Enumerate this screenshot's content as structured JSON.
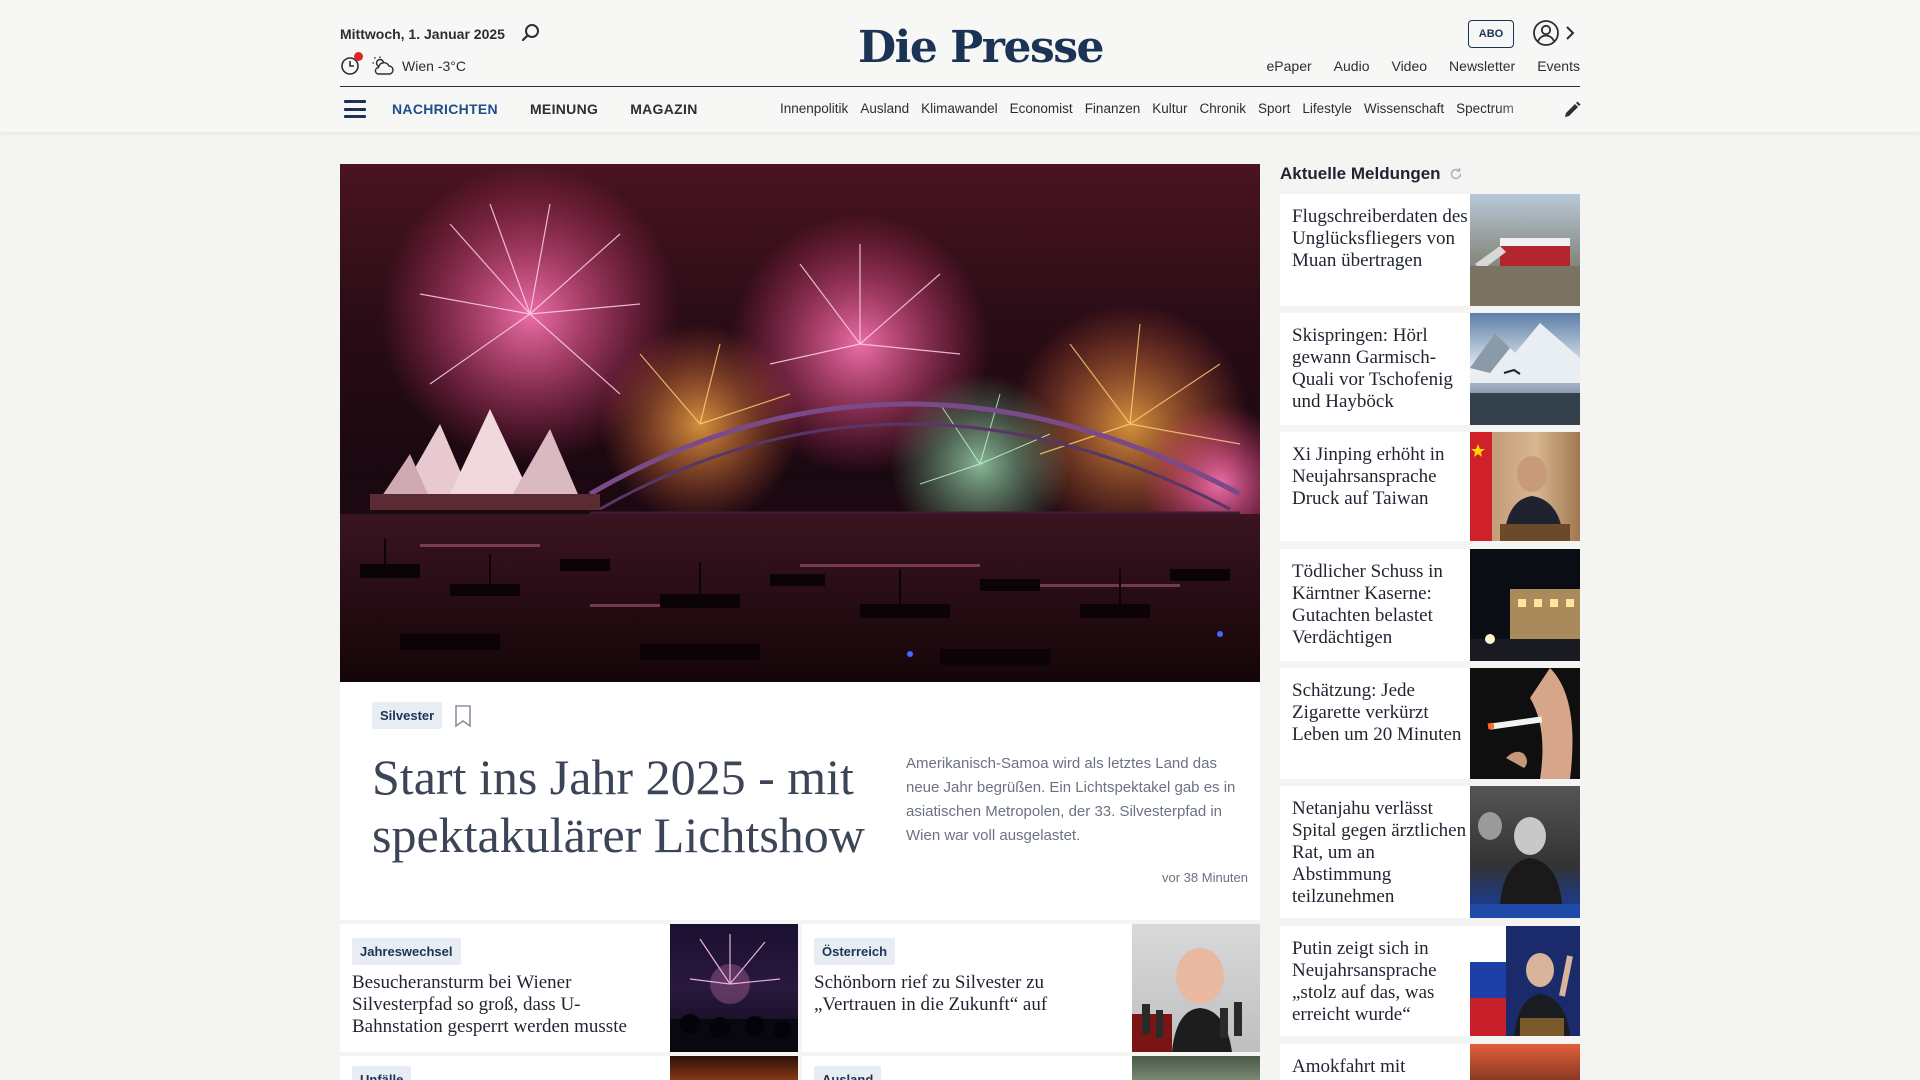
{
  "header": {
    "date": "Mittwoch, 1. Januar 2025",
    "weather": "Wien -3°C",
    "logo": "Die Presse",
    "abo_label": "ABO",
    "top_links": [
      "ePaper",
      "Audio",
      "Video",
      "Newsletter",
      "Events"
    ],
    "main_nav": [
      "NACHRICHTEN",
      "MEINUNG",
      "MAGAZIN"
    ],
    "sub_nav": [
      "Innenpolitik",
      "Ausland",
      "Klimawandel",
      "Economist",
      "Finanzen",
      "Kultur",
      "Chronik",
      "Sport",
      "Lifestyle",
      "Wissenschaft",
      "Spectrum"
    ]
  },
  "hero": {
    "tag": "Silvester",
    "title": "Start ins Jahr 2025 - mit spektakulärer Lichtshow",
    "teaser": "Amerikanisch-Samoa wird als letztes Land das neue Jahr begrüßen. Ein Lichtspektakel gab es in asiatischen Metropolen, der 33. Silvesterpfad in Wien war voll ausgelastet.",
    "time": "vor 38 Minuten"
  },
  "cards": [
    {
      "tag": "Jahreswechsel",
      "title": "Besucheransturm bei Wiener Silvesterpfad so groß, dass U-Bahnstation gesperrt werden musste"
    },
    {
      "tag": "Österreich",
      "title": "Schönborn rief zu Silvester zu „Vertrauen in die Zukunft“ auf"
    }
  ],
  "cards_partial": [
    {
      "tag": "Unfälle"
    },
    {
      "tag": "Ausland"
    }
  ],
  "sidebar": {
    "title": "Aktuelle Meldungen",
    "items": [
      {
        "title": "Flugschreiberdaten des Unglücksfliegers von Muan übertragen"
      },
      {
        "title": "Skispringen: Hörl gewann Garmisch-Quali vor Tschofenig und Hayböck"
      },
      {
        "title": "Xi Jinping erhöht in Neujahrsansprache Druck auf Taiwan"
      },
      {
        "title": "Tödlicher Schuss in Kärntner Kaserne: Gutachten belastet Verdächtigen"
      },
      {
        "title": "Schätzung: Jede Zigarette verkürzt Leben um 20 Minuten"
      },
      {
        "title": "Netanjahu verlässt Spital gegen ärztlichen Rat, um an Abstimmung teilzunehmen"
      },
      {
        "title": "Putin zeigt sich in Neujahrsansprache „stolz auf das, was erreicht wurde“"
      },
      {
        "title": "Amokfahrt mit"
      }
    ]
  },
  "colors": {
    "brand": "#1b3455",
    "nav_active": "#1d4e89",
    "alert_dot": "#e1242b",
    "page_bg": "#f4f4f2"
  }
}
